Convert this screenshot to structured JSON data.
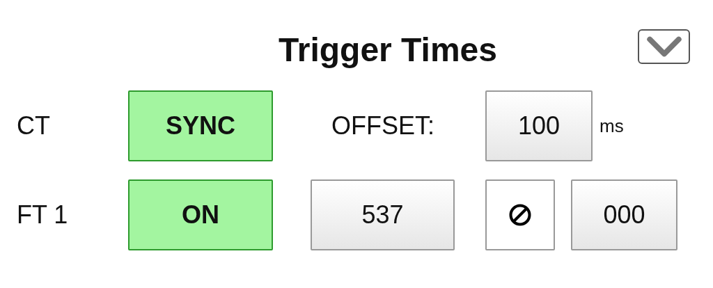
{
  "title": "Trigger Times",
  "rows": [
    {
      "kind": "offset",
      "label": "CT",
      "toggle": {
        "label": "SYNC",
        "on": true
      },
      "offset_label": "OFFSET:",
      "offset_value": "100",
      "unit": "ms"
    },
    {
      "kind": "trigger",
      "label": "FT 1",
      "toggle": {
        "label": "ON",
        "on": true
      },
      "value": "537",
      "value_2": "000"
    }
  ]
}
